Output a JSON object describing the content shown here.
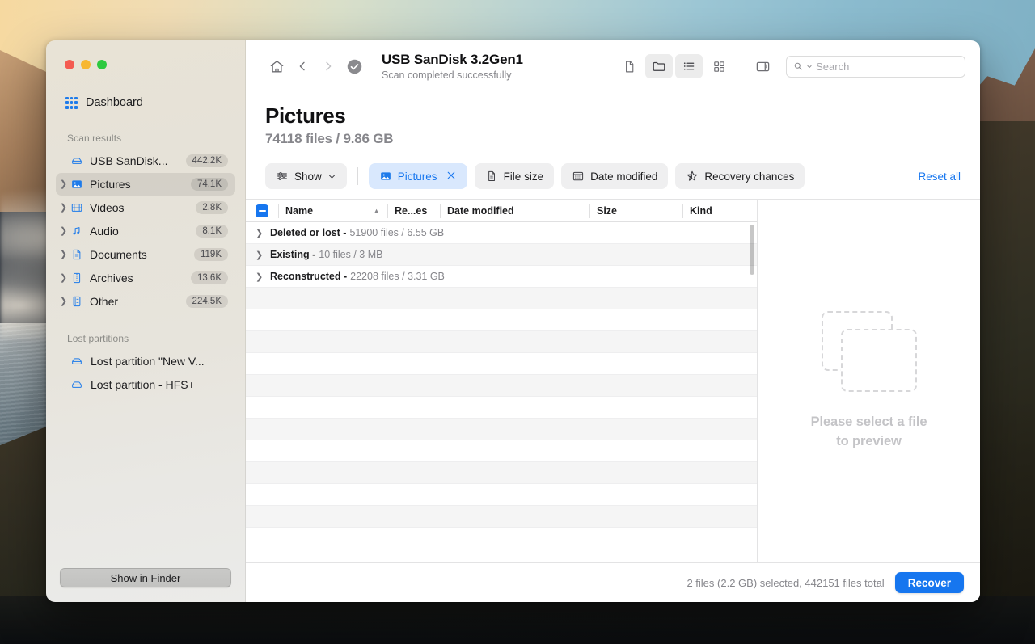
{
  "window": {
    "traffic_lights": [
      "close",
      "minimize",
      "zoom"
    ]
  },
  "sidebar": {
    "dashboard_label": "Dashboard",
    "scan_results_title": "Scan results",
    "scan_results": [
      {
        "icon": "drive-icon",
        "label": "USB  SanDisk...",
        "count": "442.2K",
        "expandable": false,
        "selected": false
      },
      {
        "icon": "pictures-icon",
        "label": "Pictures",
        "count": "74.1K",
        "expandable": true,
        "selected": true
      },
      {
        "icon": "videos-icon",
        "label": "Videos",
        "count": "2.8K",
        "expandable": true,
        "selected": false
      },
      {
        "icon": "audio-icon",
        "label": "Audio",
        "count": "8.1K",
        "expandable": true,
        "selected": false
      },
      {
        "icon": "documents-icon",
        "label": "Documents",
        "count": "119K",
        "expandable": true,
        "selected": false
      },
      {
        "icon": "archives-icon",
        "label": "Archives",
        "count": "13.6K",
        "expandable": true,
        "selected": false
      },
      {
        "icon": "other-icon",
        "label": "Other",
        "count": "224.5K",
        "expandable": true,
        "selected": false
      }
    ],
    "lost_partitions_title": "Lost partitions",
    "lost_partitions": [
      {
        "icon": "drive-icon",
        "label": "Lost partition \"New V..."
      },
      {
        "icon": "drive-icon",
        "label": "Lost partition - HFS+"
      }
    ],
    "show_in_finder_label": "Show in Finder"
  },
  "toolbar": {
    "home_icon": "home-icon",
    "back_icon": "chevron-left-icon",
    "forward_icon": "chevron-right-icon",
    "status_icon": "check-circle-icon",
    "title": "USB  SanDisk 3.2Gen1",
    "subtitle": "Scan completed successfully",
    "view_buttons": [
      {
        "icon": "file-view-icon",
        "active": false
      },
      {
        "icon": "folder-view-icon",
        "active": true
      },
      {
        "icon": "list-view-icon",
        "active": true
      },
      {
        "icon": "grid-view-icon",
        "active": false
      }
    ],
    "panel_icon": "sidebar-panel-icon",
    "search_placeholder": "Search",
    "search_value": ""
  },
  "page": {
    "title": "Pictures",
    "subtitle": "74118 files / 9.86 GB"
  },
  "filters": {
    "show_label": "Show",
    "show_icon": "sliders-icon",
    "chips": [
      {
        "icon": "pictures-icon",
        "label": "Pictures",
        "active": true,
        "closable": true
      },
      {
        "icon": "file-icon",
        "label": "File size",
        "active": false,
        "closable": false
      },
      {
        "icon": "calendar-icon",
        "label": "Date modified",
        "active": false,
        "closable": false
      },
      {
        "icon": "star-icon",
        "label": "Recovery chances",
        "active": false,
        "closable": false
      }
    ],
    "reset_all_label": "Reset all"
  },
  "table": {
    "header_checkbox_state": "indeterminate",
    "columns": [
      {
        "key": "name",
        "label": "Name",
        "sort": "asc"
      },
      {
        "key": "rec",
        "label": "Re...es",
        "sort": ""
      },
      {
        "key": "date",
        "label": "Date modified",
        "sort": ""
      },
      {
        "key": "size",
        "label": "Size",
        "sort": ""
      },
      {
        "key": "kind",
        "label": "Kind",
        "sort": ""
      }
    ],
    "groups": [
      {
        "label": "Deleted or lost -",
        "meta": "51900 files / 6.55 GB",
        "expanded": false
      },
      {
        "label": "Existing -",
        "meta": "10 files / 3 MB",
        "expanded": false
      },
      {
        "label": "Reconstructed -",
        "meta": "22208 files / 3.31 GB",
        "expanded": false
      }
    ],
    "empty_row_count": 12
  },
  "preview": {
    "placeholder_icon": "empty-preview-icon",
    "line1": "Please select a file",
    "line2": "to preview"
  },
  "status": {
    "text": "2 files (2.2 GB) selected, 442151 files total",
    "recover_label": "Recover"
  },
  "colors": {
    "accent": "#1676ef",
    "chip_active_bg": "#d9e8fd",
    "muted_text": "#86868b",
    "traffic_red": "#f45b51",
    "traffic_yellow": "#f7b731",
    "traffic_green": "#2dc93f"
  }
}
